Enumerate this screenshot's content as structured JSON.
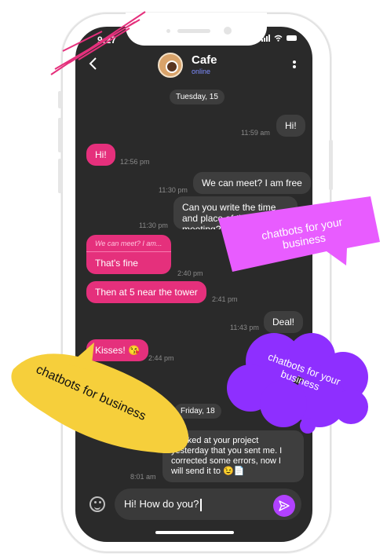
{
  "status_bar": {
    "time": "9:27"
  },
  "header": {
    "back_icon": "chevron-left-icon",
    "name": "Cafe",
    "status": "online",
    "menu_icon": "vertical-dots-icon"
  },
  "chat": {
    "date1": "Tuesday, 15",
    "date2": "Friday, 18",
    "messages": [
      {
        "text": "Hi!",
        "time": "11:59 am"
      },
      {
        "text": "Hi!",
        "time": "12:56 pm"
      },
      {
        "text": "We can meet? I am free",
        "time": "11:30 pm"
      },
      {
        "text": "Can you write the time and place of the meeting?",
        "time": "11:30 pm"
      },
      {
        "quote": "We can meet? I am...",
        "text": "That's fine",
        "time": "2:40 pm"
      },
      {
        "text": "Then at 5 near the tower",
        "time": "2:41 pm"
      },
      {
        "text": "Deal!",
        "time": "11:43 pm"
      },
      {
        "text": "Kisses! 😘",
        "time": "2:44 pm"
      },
      {
        "text": "I looked at your project yesterday that you sent me. I corrected some errors, now I will send it to 😉📄",
        "time": "8:01 am"
      }
    ]
  },
  "composer": {
    "emoji_icon": "emoji-icon",
    "value": "Hi! How do you?",
    "send_icon": "send-icon"
  },
  "stickers": {
    "pink": "chatbots for your business",
    "purple": "chatbots for your business",
    "yellow": "chatbots for business"
  },
  "colors": {
    "incoming": "#e5307c",
    "outgoing": "#3e3e3e",
    "pink_sticker": "#e85cff",
    "purple_sticker": "#8e2fff",
    "yellow_sticker": "#f6cf3b",
    "send": "#b141ff"
  }
}
